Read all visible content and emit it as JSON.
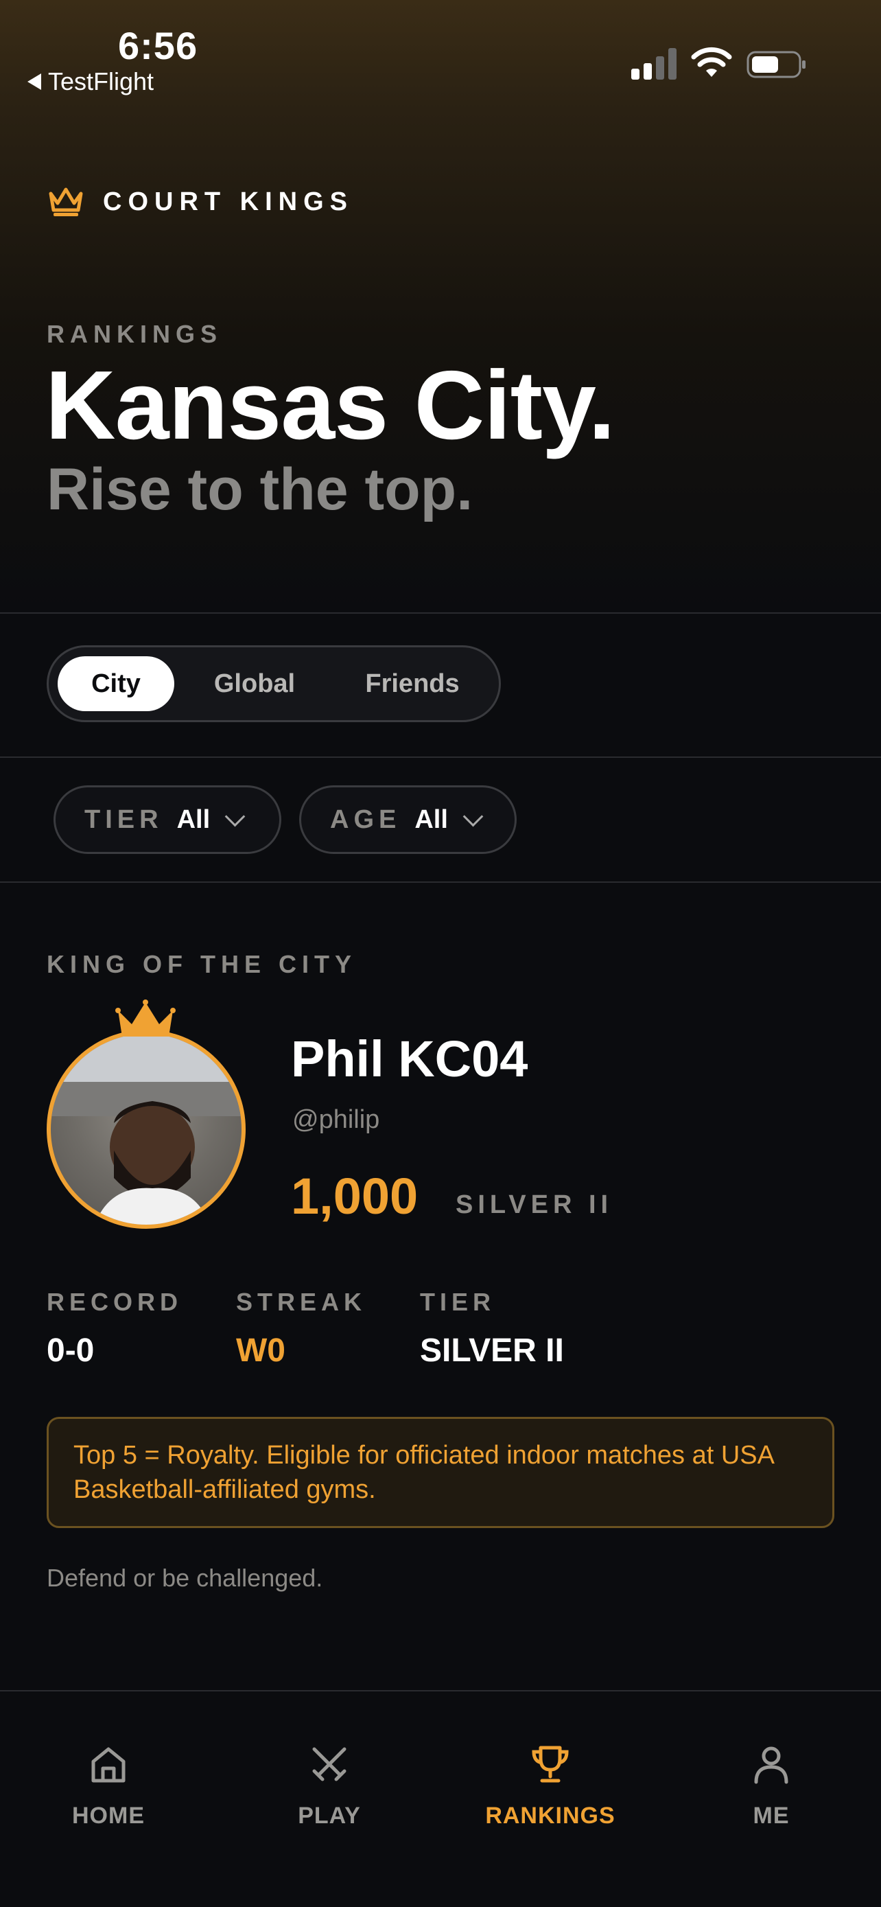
{
  "status_bar": {
    "time": "6:56",
    "back_label": "TestFlight"
  },
  "brand": {
    "name": "COURT KINGS"
  },
  "header": {
    "eyebrow": "RANKINGS",
    "title": "Kansas City.",
    "subtitle": "Rise to the top."
  },
  "scope_tabs": [
    {
      "label": "City",
      "active": true
    },
    {
      "label": "Global",
      "active": false
    },
    {
      "label": "Friends",
      "active": false
    }
  ],
  "filters": {
    "tier": {
      "label": "TIER",
      "value": "All"
    },
    "age": {
      "label": "AGE",
      "value": "All"
    }
  },
  "king": {
    "section_label": "KING OF THE CITY",
    "name": "Phil KC04",
    "handle": "@philip",
    "points": "1,000",
    "points_tier": "SILVER II",
    "stats": [
      {
        "label": "RECORD",
        "value": "0-0"
      },
      {
        "label": "STREAK",
        "value": "W0"
      },
      {
        "label": "TIER",
        "value": "SILVER II"
      }
    ],
    "notice": "Top 5 = Royalty. Eligible for officiated indoor matches at USA Basketball-affiliated gyms.",
    "tagline": "Defend or be challenged."
  },
  "bottom_nav": [
    {
      "label": "HOME",
      "icon": "home-icon",
      "active": false
    },
    {
      "label": "PLAY",
      "icon": "crossed-swords-icon",
      "active": false
    },
    {
      "label": "RANKINGS",
      "icon": "trophy-icon",
      "active": true
    },
    {
      "label": "ME",
      "icon": "person-icon",
      "active": false
    }
  ],
  "colors": {
    "accent": "#f0a233",
    "background": "#0b0c0f",
    "muted": "#8c8a86"
  }
}
